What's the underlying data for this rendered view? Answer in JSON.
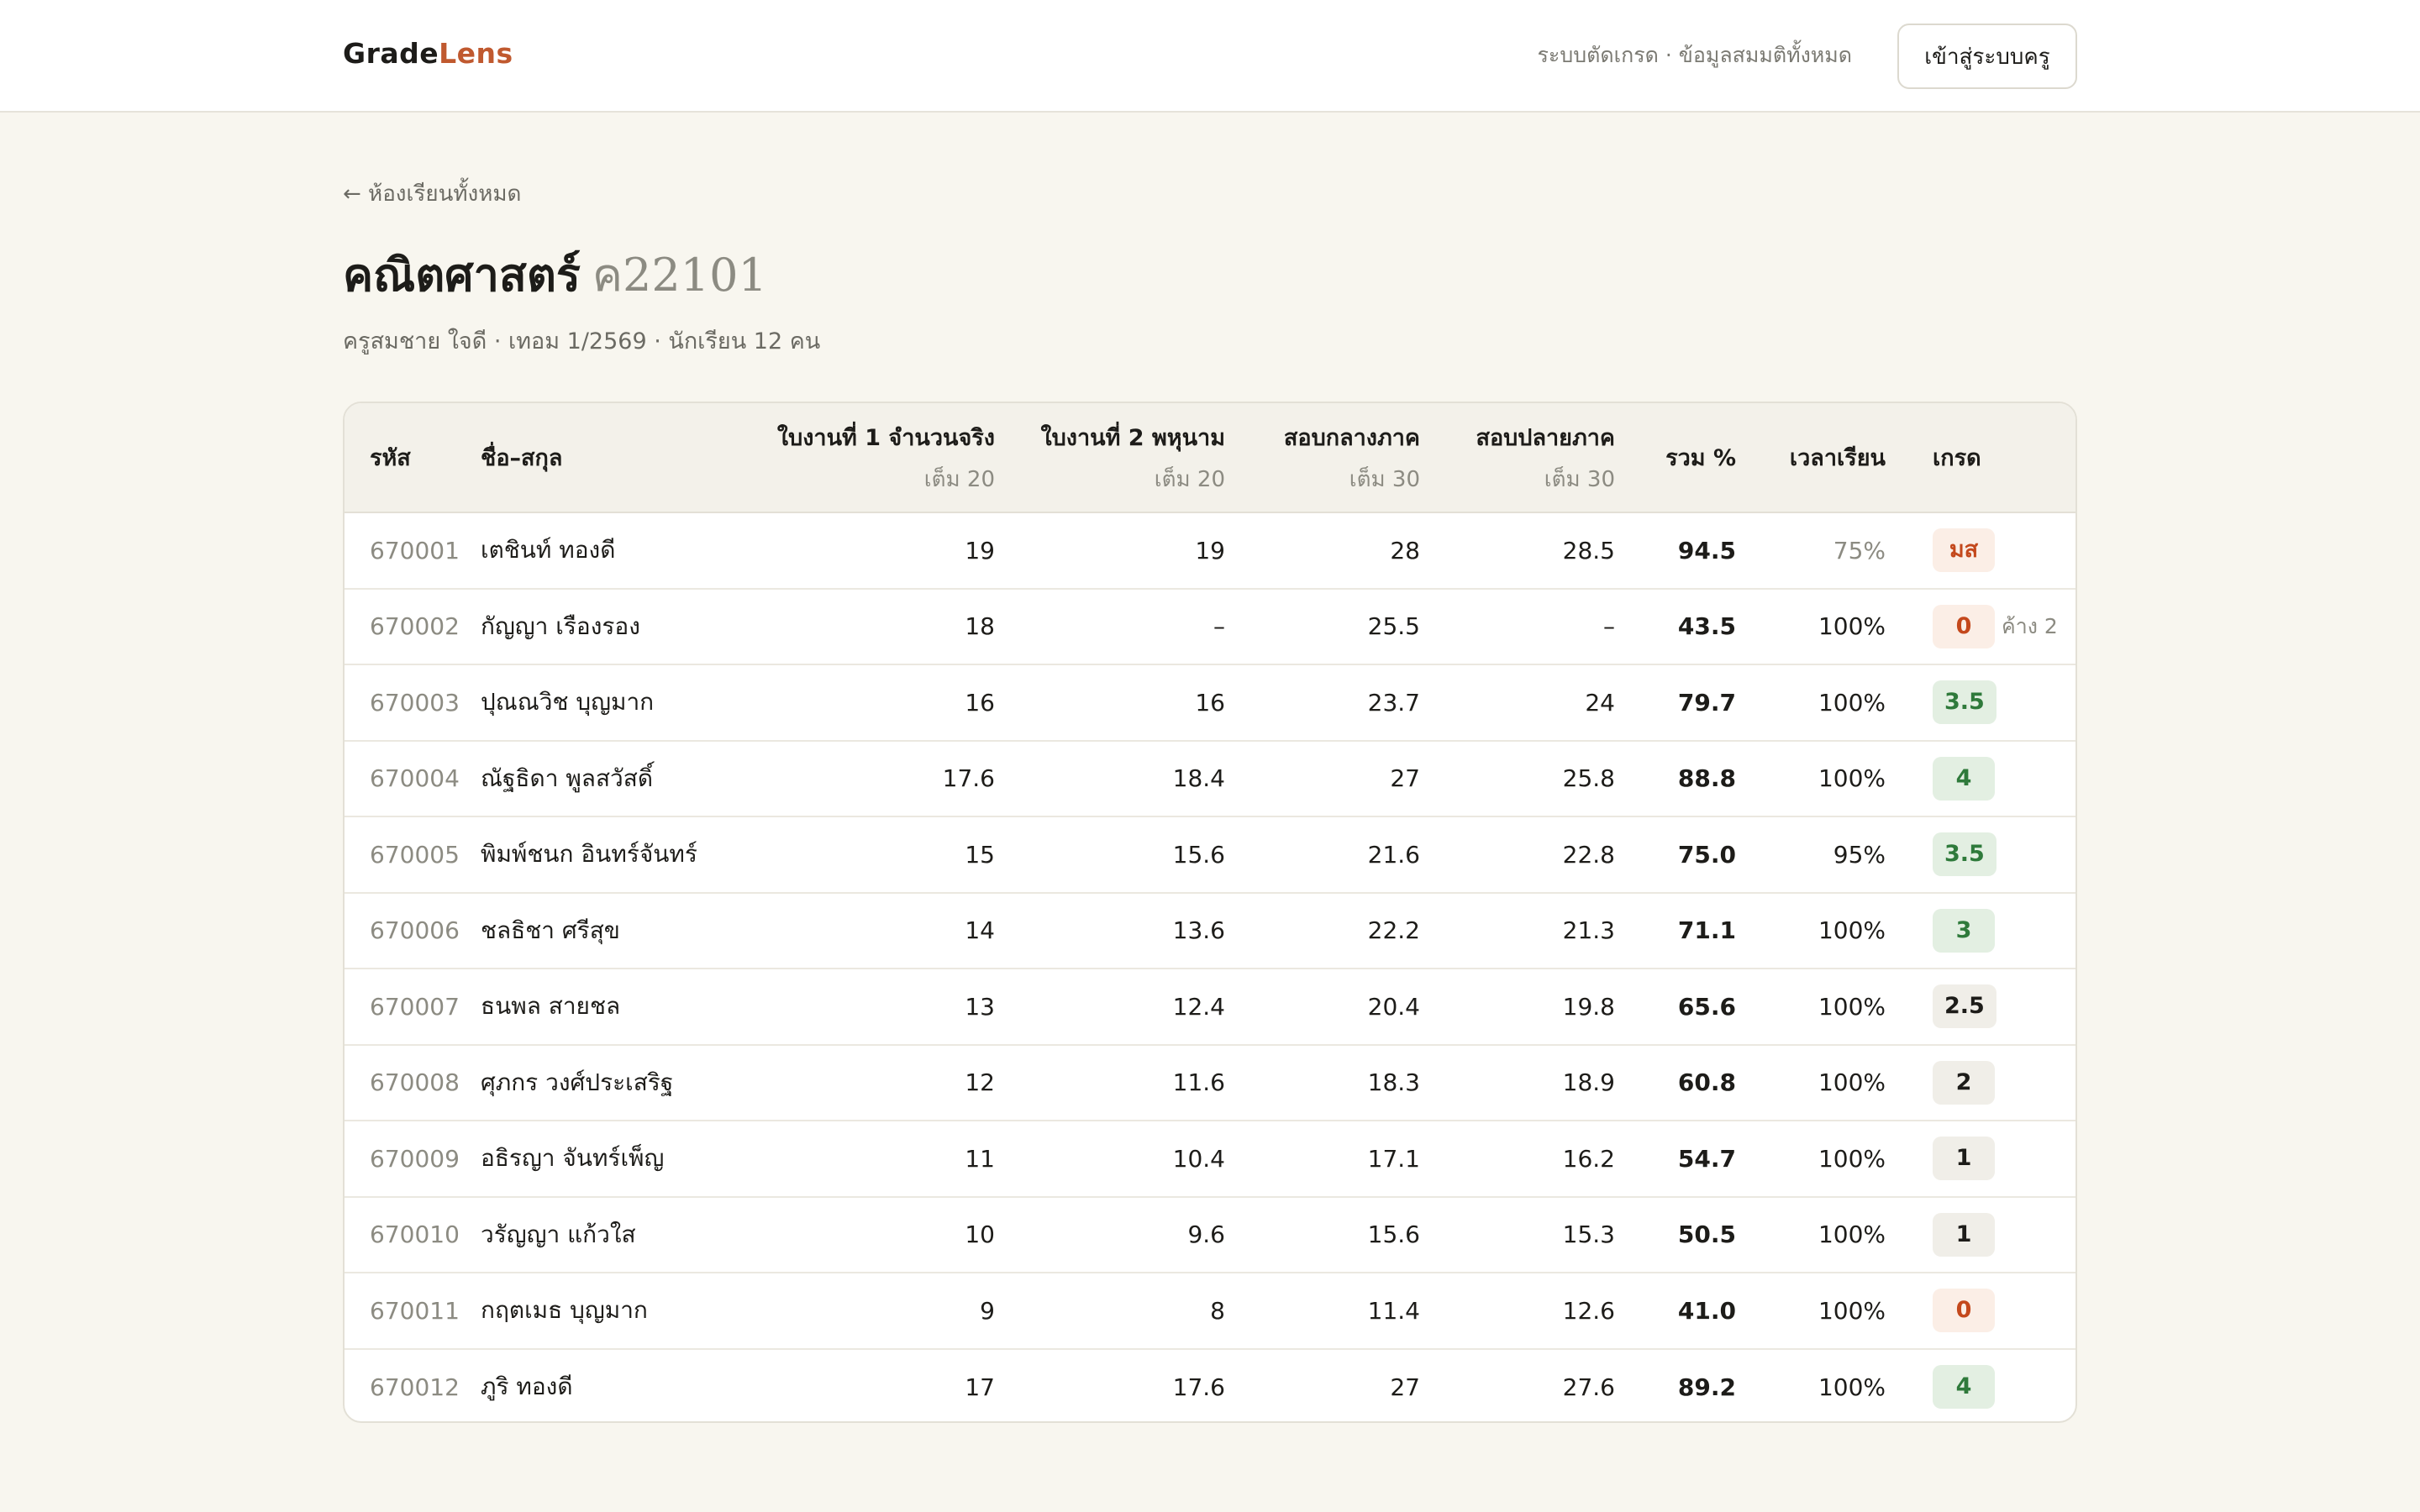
{
  "header": {
    "brand_part1": "Grade",
    "brand_part2": "Lens",
    "note": "ระบบตัดเกรด · ข้อมูลสมมติทั้งหมด",
    "login_label": "เข้าสู่ระบบครู"
  },
  "page": {
    "back_label": "← ห้องเรียนทั้งหมด",
    "title": "คณิตศาสตร์",
    "course_code": "ค22101",
    "meta": "ครูสมชาย ใจดี · เทอม 1/2569 · นักเรียน 12 คน"
  },
  "colors": {
    "accent": "#c0592f",
    "grade_fail": "#c4481c",
    "grade_good": "#2f7a3b"
  },
  "table": {
    "columns": {
      "id": "รหัส",
      "name": "ชื่อ–สกุล",
      "w1": "ใบงานที่ 1 จำนวนจริง",
      "w1_max": "เต็ม 20",
      "w2": "ใบงานที่ 2 พหุนาม",
      "w2_max": "เต็ม 20",
      "mid": "สอบกลางภาค",
      "mid_max": "เต็ม 30",
      "final": "สอบปลายภาค",
      "final_max": "เต็ม 30",
      "total": "รวม %",
      "attendance": "เวลาเรียน",
      "grade": "เกรด"
    },
    "rows": [
      {
        "id": "670001",
        "name": "เตชินท์ ทองดี",
        "w1": "19",
        "w2": "19",
        "mid": "28",
        "final": "28.5",
        "total": "94.5",
        "attendance": "75%",
        "grade": "มส",
        "grade_style": "red",
        "note": "",
        "att_low": true
      },
      {
        "id": "670002",
        "name": "กัญญา เรืองรอง",
        "w1": "18",
        "w2": "–",
        "mid": "25.5",
        "final": "–",
        "total": "43.5",
        "attendance": "100%",
        "grade": "0",
        "grade_style": "red",
        "note": "ค้าง 2",
        "att_low": false
      },
      {
        "id": "670003",
        "name": "ปุณณวิช บุญมาก",
        "w1": "16",
        "w2": "16",
        "mid": "23.7",
        "final": "24",
        "total": "79.7",
        "attendance": "100%",
        "grade": "3.5",
        "grade_style": "green",
        "note": "",
        "att_low": false
      },
      {
        "id": "670004",
        "name": "ณัฐธิดา พูลสวัสดิ์",
        "w1": "17.6",
        "w2": "18.4",
        "mid": "27",
        "final": "25.8",
        "total": "88.8",
        "attendance": "100%",
        "grade": "4",
        "grade_style": "green",
        "note": "",
        "att_low": false
      },
      {
        "id": "670005",
        "name": "พิมพ์ชนก อินทร์จันทร์",
        "w1": "15",
        "w2": "15.6",
        "mid": "21.6",
        "final": "22.8",
        "total": "75.0",
        "attendance": "95%",
        "grade": "3.5",
        "grade_style": "green",
        "note": "",
        "att_low": false
      },
      {
        "id": "670006",
        "name": "ชลธิชา ศรีสุข",
        "w1": "14",
        "w2": "13.6",
        "mid": "22.2",
        "final": "21.3",
        "total": "71.1",
        "attendance": "100%",
        "grade": "3",
        "grade_style": "green",
        "note": "",
        "att_low": false
      },
      {
        "id": "670007",
        "name": "ธนพล สายชล",
        "w1": "13",
        "w2": "12.4",
        "mid": "20.4",
        "final": "19.8",
        "total": "65.6",
        "attendance": "100%",
        "grade": "2.5",
        "grade_style": "gray",
        "note": "",
        "att_low": false
      },
      {
        "id": "670008",
        "name": "ศุภกร วงศ์ประเสริฐ",
        "w1": "12",
        "w2": "11.6",
        "mid": "18.3",
        "final": "18.9",
        "total": "60.8",
        "attendance": "100%",
        "grade": "2",
        "grade_style": "gray",
        "note": "",
        "att_low": false
      },
      {
        "id": "670009",
        "name": "อธิรญา จันทร์เพ็ญ",
        "w1": "11",
        "w2": "10.4",
        "mid": "17.1",
        "final": "16.2",
        "total": "54.7",
        "attendance": "100%",
        "grade": "1",
        "grade_style": "gray",
        "note": "",
        "att_low": false
      },
      {
        "id": "670010",
        "name": "วรัญญา แก้วใส",
        "w1": "10",
        "w2": "9.6",
        "mid": "15.6",
        "final": "15.3",
        "total": "50.5",
        "attendance": "100%",
        "grade": "1",
        "grade_style": "gray",
        "note": "",
        "att_low": false
      },
      {
        "id": "670011",
        "name": "กฤตเมธ บุญมาก",
        "w1": "9",
        "w2": "8",
        "mid": "11.4",
        "final": "12.6",
        "total": "41.0",
        "attendance": "100%",
        "grade": "0",
        "grade_style": "red",
        "note": "",
        "att_low": false
      },
      {
        "id": "670012",
        "name": "ภูริ ทองดี",
        "w1": "17",
        "w2": "17.6",
        "mid": "27",
        "final": "27.6",
        "total": "89.2",
        "attendance": "100%",
        "grade": "4",
        "grade_style": "green",
        "note": "",
        "att_low": false
      }
    ]
  }
}
